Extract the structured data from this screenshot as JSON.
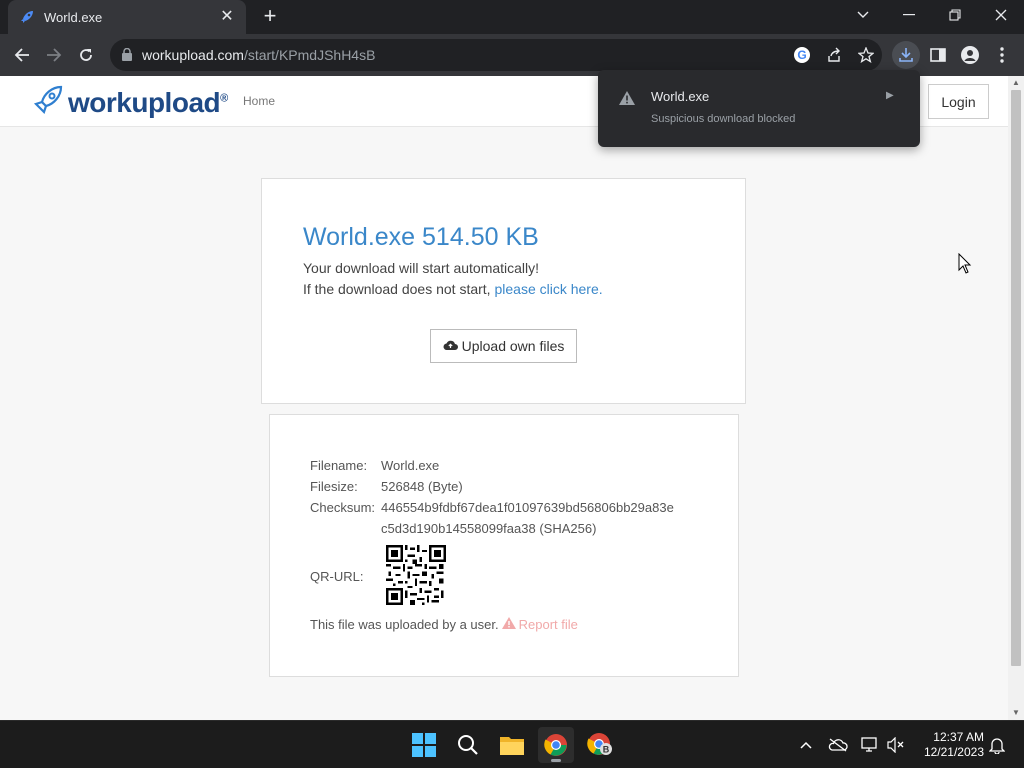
{
  "browser": {
    "tab_title": "World.exe",
    "tab_close_glyph": "✕",
    "new_tab_glyph": "+",
    "url_host": "workupload.com",
    "url_path": "/start/KPmdJShH4sB"
  },
  "site": {
    "logo_text": "workupload",
    "logo_reg": "®",
    "nav_home": "Home",
    "login_label": "Login",
    "brand_color": "#1f4a86",
    "accent_color": "#3a87c9"
  },
  "download_card": {
    "heading": "World.exe 514.50 KB",
    "line1": "Your download will start automatically!",
    "line2_prefix": "If the download does not start, ",
    "line2_link": "please click here.",
    "upload_button": "Upload own files"
  },
  "file_info": {
    "filename_label": "Filename:",
    "filename_value": "World.exe",
    "filesize_label": "Filesize:",
    "filesize_value": "526848 (Byte)",
    "checksum_label": "Checksum:",
    "checksum_line1": "446554b9fdbf67dea1f01097639bd56806bb29a83e",
    "checksum_line2": "c5d3d190b14558099faa38 (SHA256)",
    "qr_label": "QR-URL:",
    "uploaded_text": "This file was uploaded by a user.",
    "report_link": "Report file"
  },
  "download_bubble": {
    "filename": "World.exe",
    "status": "Suspicious download blocked",
    "icon": "warning-icon"
  },
  "taskbar": {
    "time": "12:37 AM",
    "date": "12/21/2023",
    "apps": [
      "windows-start-icon",
      "search-icon",
      "file-explorer-icon",
      "chrome-icon",
      "chrome-profile-icon"
    ]
  }
}
